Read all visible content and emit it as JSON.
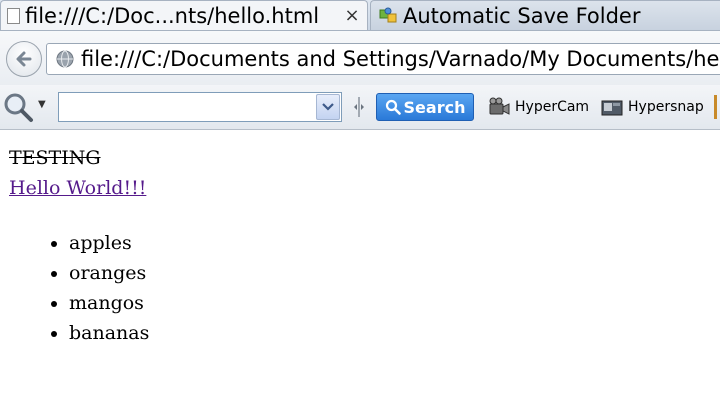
{
  "tabs": [
    {
      "title": "file:///C:/Doc...nts/hello.html",
      "close": "×"
    },
    {
      "title": "Automatic Save Folder"
    }
  ],
  "navbar": {
    "url": "file:///C:/Documents and Settings/Varnado/My Documents/he"
  },
  "toolbar": {
    "search_value": "",
    "search_button_label": "Search",
    "hypercam_label": "HyperCam",
    "hypersnap_label": "Hypersnap"
  },
  "page": {
    "struck_text": "TESTING",
    "link_text": "Hello World!!!",
    "list_items": [
      "apples",
      "oranges",
      "mangos",
      "bananas"
    ]
  },
  "colors": {
    "link_visited": "#551a8b",
    "search_button": "#2a79d8"
  },
  "icons": {
    "back": "back-arrow-icon",
    "globe": "globe-icon",
    "search": "magnifier-icon",
    "close": "close-icon"
  }
}
